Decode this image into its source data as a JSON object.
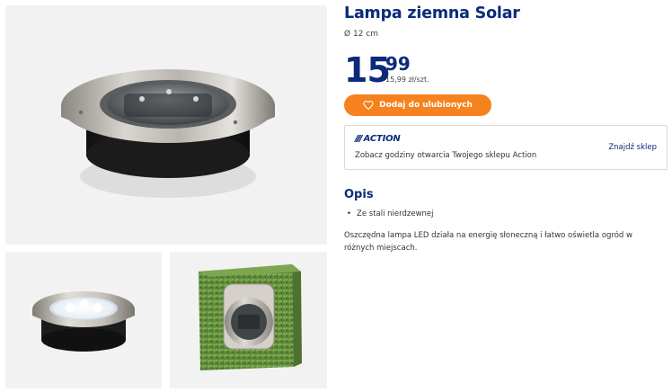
{
  "product": {
    "title": "Lampa ziemna Solar",
    "size": "Ø 12 cm",
    "price_int": "15",
    "price_dec": "99",
    "unit_price": "15,99 zł/szt."
  },
  "favorite_button": {
    "icon": "heart-icon",
    "label": "Dodaj do ulubionych"
  },
  "store_box": {
    "logo": "ACTION",
    "text": "Zobacz godziny otwarcia Twojego sklepu Action",
    "link": "Znajdź sklep"
  },
  "description": {
    "heading": "Opis",
    "bullets": [
      "Ze stali nierdzewnej"
    ],
    "text": "Oszczędna lampa LED działa na energię słoneczną i łatwo oświetla ogród w różnych miejscach."
  },
  "colors": {
    "brand_blue": "#0b2a7a",
    "accent_orange": "#f5821f",
    "image_bg": "#f2f2f2"
  }
}
